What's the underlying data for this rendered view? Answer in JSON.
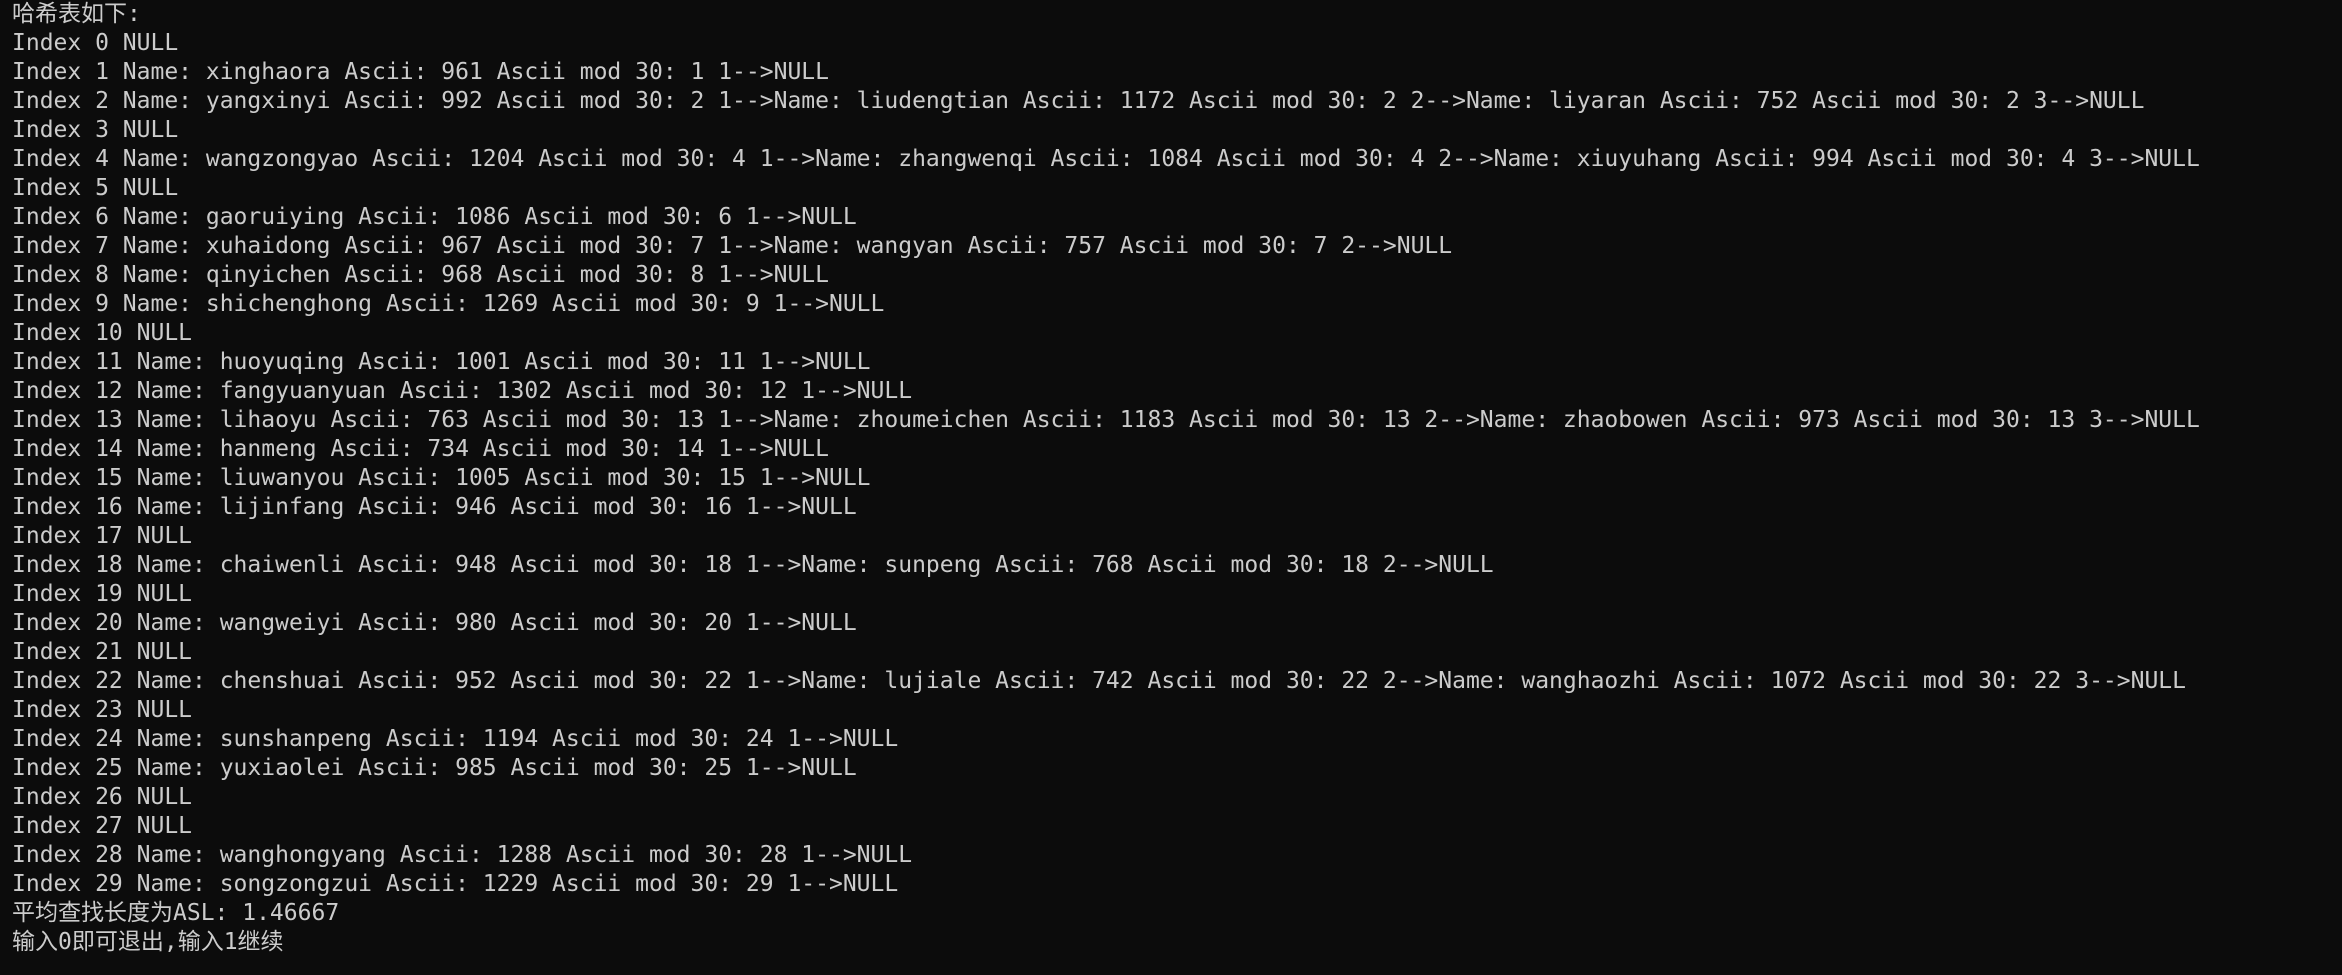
{
  "terminal": {
    "lines": [
      "哈希表如下:",
      "Index 0 NULL",
      "Index 1 Name: xinghaora Ascii: 961 Ascii mod 30: 1 1-->NULL",
      "Index 2 Name: yangxinyi Ascii: 992 Ascii mod 30: 2 1-->Name: liudengtian Ascii: 1172 Ascii mod 30: 2 2-->Name: liyaran Ascii: 752 Ascii mod 30: 2 3-->NULL",
      "Index 3 NULL",
      "Index 4 Name: wangzongyao Ascii: 1204 Ascii mod 30: 4 1-->Name: zhangwenqi Ascii: 1084 Ascii mod 30: 4 2-->Name: xiuyuhang Ascii: 994 Ascii mod 30: 4 3-->NULL",
      "Index 5 NULL",
      "Index 6 Name: gaoruiying Ascii: 1086 Ascii mod 30: 6 1-->NULL",
      "Index 7 Name: xuhaidong Ascii: 967 Ascii mod 30: 7 1-->Name: wangyan Ascii: 757 Ascii mod 30: 7 2-->NULL",
      "Index 8 Name: qinyichen Ascii: 968 Ascii mod 30: 8 1-->NULL",
      "Index 9 Name: shichenghong Ascii: 1269 Ascii mod 30: 9 1-->NULL",
      "Index 10 NULL",
      "Index 11 Name: huoyuqing Ascii: 1001 Ascii mod 30: 11 1-->NULL",
      "Index 12 Name: fangyuanyuan Ascii: 1302 Ascii mod 30: 12 1-->NULL",
      "Index 13 Name: lihaoyu Ascii: 763 Ascii mod 30: 13 1-->Name: zhoumeichen Ascii: 1183 Ascii mod 30: 13 2-->Name: zhaobowen Ascii: 973 Ascii mod 30: 13 3-->NULL",
      "Index 14 Name: hanmeng Ascii: 734 Ascii mod 30: 14 1-->NULL",
      "Index 15 Name: liuwanyou Ascii: 1005 Ascii mod 30: 15 1-->NULL",
      "Index 16 Name: lijinfang Ascii: 946 Ascii mod 30: 16 1-->NULL",
      "Index 17 NULL",
      "Index 18 Name: chaiwenli Ascii: 948 Ascii mod 30: 18 1-->Name: sunpeng Ascii: 768 Ascii mod 30: 18 2-->NULL",
      "Index 19 NULL",
      "Index 20 Name: wangweiyi Ascii: 980 Ascii mod 30: 20 1-->NULL",
      "Index 21 NULL",
      "Index 22 Name: chenshuai Ascii: 952 Ascii mod 30: 22 1-->Name: lujiale Ascii: 742 Ascii mod 30: 22 2-->Name: wanghaozhi Ascii: 1072 Ascii mod 30: 22 3-->NULL",
      "Index 23 NULL",
      "Index 24 Name: sunshanpeng Ascii: 1194 Ascii mod 30: 24 1-->NULL",
      "Index 25 Name: yuxiaolei Ascii: 985 Ascii mod 30: 25 1-->NULL",
      "Index 26 NULL",
      "Index 27 NULL",
      "Index 28 Name: wanghongyang Ascii: 1288 Ascii mod 30: 28 1-->NULL",
      "Index 29 Name: songzongzui Ascii: 1229 Ascii mod 30: 29 1-->NULL",
      "平均查找长度为ASL: 1.46667",
      "输入0即可退出,输入1继续"
    ]
  },
  "colors": {
    "background": "#0c0c0c",
    "text": "#cccccc"
  }
}
